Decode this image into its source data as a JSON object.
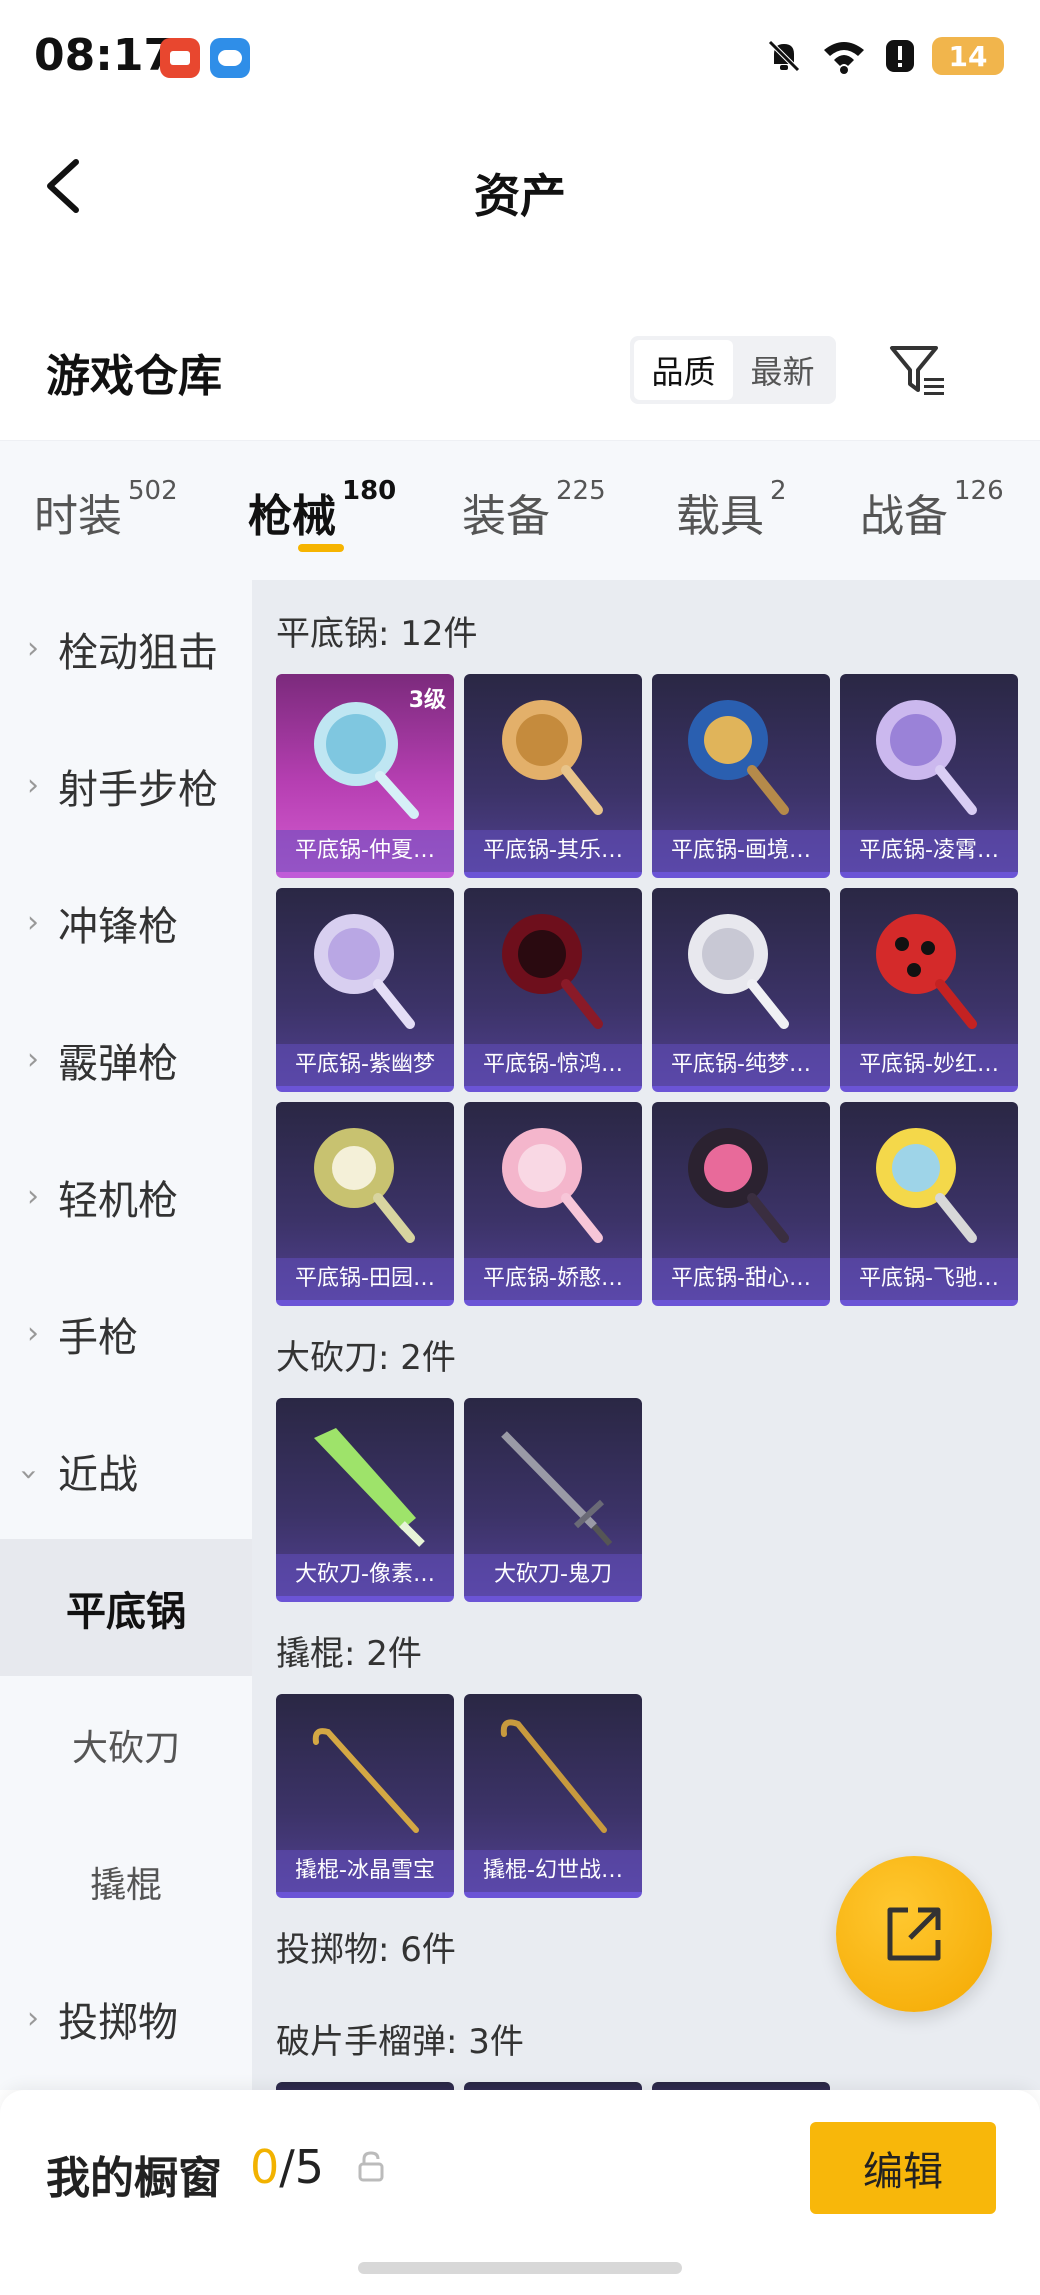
{
  "status": {
    "time": "08:17",
    "battery": "14"
  },
  "header": {
    "title": "资产"
  },
  "warehouse": {
    "title": "游戏仓库",
    "sort_options": [
      "品质",
      "最新"
    ]
  },
  "tabs": [
    {
      "label": "时装",
      "count": "502"
    },
    {
      "label": "枪械",
      "count": "180"
    },
    {
      "label": "装备",
      "count": "225"
    },
    {
      "label": "载具",
      "count": "2"
    },
    {
      "label": "战备",
      "count": "126"
    }
  ],
  "sidebar": {
    "items": [
      "栓动狙击",
      "射手步枪",
      "冲锋枪",
      "霰弹枪",
      "轻机枪",
      "手枪",
      "近战"
    ],
    "sub_items": [
      "平底锅",
      "大砍刀",
      "撬棍"
    ],
    "after": "投掷物"
  },
  "sections": {
    "pan": {
      "title": "平底锅: 12件",
      "items": [
        "平底锅-仲夏…",
        "平底锅-其乐…",
        "平底锅-画境…",
        "平底锅-凌霄…",
        "平底锅-紫幽梦",
        "平底锅-惊鸿…",
        "平底锅-纯梦…",
        "平底锅-妙红…",
        "平底锅-田园…",
        "平底锅-娇憨…",
        "平底锅-甜心…",
        "平底锅-飞驰…"
      ],
      "badge": "3级"
    },
    "machete": {
      "title": "大砍刀: 2件",
      "items": [
        "大砍刀-像素…",
        "大砍刀-鬼刀"
      ]
    },
    "crowbar": {
      "title": "撬棍: 2件",
      "items": [
        "撬棍-冰晶雪宝",
        "撬棍-幻世战…"
      ]
    },
    "throwables": {
      "title": "投掷物: 6件"
    },
    "frag": {
      "title": "破片手榴弹: 3件"
    }
  },
  "bottom": {
    "label": "我的橱窗",
    "count_used": "0",
    "count_total": "/5",
    "edit": "编辑"
  },
  "colors": {
    "accent": "#f8b70a",
    "card_purple": "#3c3368",
    "card_pink": "#b63fb2"
  }
}
